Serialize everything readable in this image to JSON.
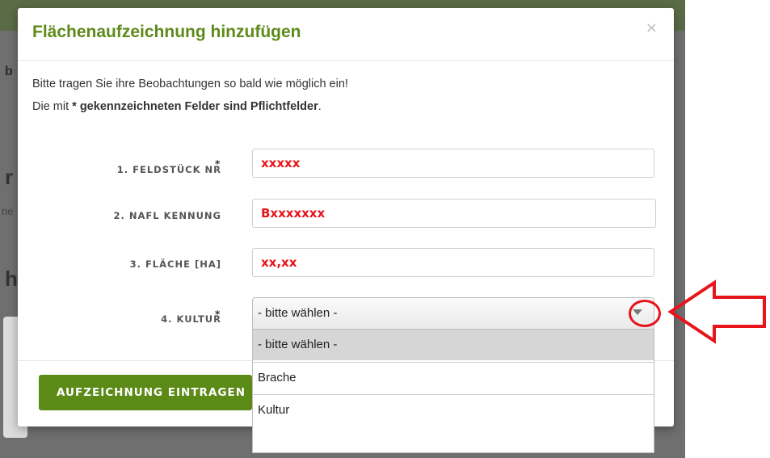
{
  "background": {
    "fragment_top": "b",
    "fragment_mid": "r",
    "fragment_low": "h",
    "fragment_small": "ne"
  },
  "modal": {
    "title": "Flächenaufzeichnung hinzufügen",
    "close_symbol": "×",
    "intro_line1": "Bitte tragen Sie ihre Beobachtungen so bald wie möglich ein!",
    "intro_line2_pre": "Die mit ",
    "intro_line2_bold": "* gekennzeichneten Felder sind Pflichtfelder",
    "intro_line2_post": ".",
    "fields": [
      {
        "label": "1. FELDSTÜCK NR",
        "required_mark": "*",
        "value": "xxxxx"
      },
      {
        "label": "2. NAFL KENNUNG",
        "required_mark": "",
        "value": "Bxxxxxxx"
      },
      {
        "label": "3. FLÄCHE [HA]",
        "required_mark": "",
        "value": "xx,xx"
      },
      {
        "label": "4. KULTUR",
        "required_mark": "*",
        "selected": "- bitte wählen -"
      }
    ],
    "submit_label": "AUFZEICHNUNG EINTRAGEN"
  },
  "dropdown": {
    "options": [
      "- bitte wählen -",
      "Brache",
      "Kultur"
    ]
  },
  "colors": {
    "title_green": "#5e8a1b",
    "button_green": "#5c8a17",
    "annotation_red": "#e8141b",
    "value_red": "#e8141b"
  },
  "icons": {
    "close": "close-icon",
    "select_arrow": "chevron-down-icon",
    "annotation": "arrow-left-icon"
  }
}
